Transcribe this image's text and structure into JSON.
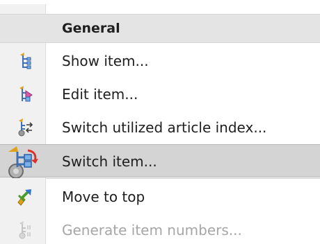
{
  "menu": {
    "section_title": "General",
    "items": [
      {
        "label": "Show item...",
        "icon": "show-item-icon",
        "state": "normal"
      },
      {
        "label": "Edit item...",
        "icon": "edit-item-icon",
        "state": "normal"
      },
      {
        "label": "Switch utilized article index...",
        "icon": "switch-article-index-icon",
        "state": "normal"
      },
      {
        "label": "Switch item...",
        "icon": "switch-item-icon",
        "state": "selected"
      },
      {
        "label": "Move to top",
        "icon": "move-to-top-icon",
        "state": "normal"
      },
      {
        "label": "Generate item numbers...",
        "icon": "generate-item-numbers-icon",
        "state": "disabled"
      }
    ]
  },
  "colors": {
    "menu_background": "#ffffff",
    "gutter_background": "#f1f1f1",
    "section_header_background": "#e4e4e4",
    "selected_item_background": "#d4d4d4",
    "text": "#1e1e1e",
    "disabled_text": "#a6a6a6"
  }
}
